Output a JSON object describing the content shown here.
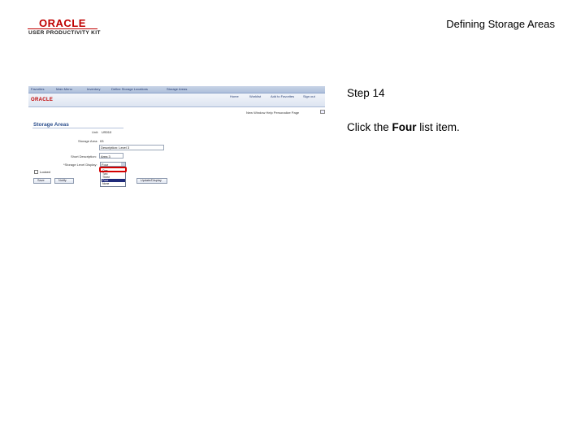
{
  "header": {
    "logo_brand": "ORACLE",
    "logo_sub": "USER PRODUCTIVITY KIT",
    "title": "Defining Storage Areas"
  },
  "step": {
    "label": "Step 14",
    "instruction_prefix": "Click the ",
    "instruction_target": "Four",
    "instruction_suffix": " list item."
  },
  "screenshot": {
    "breadcrumbs": [
      "Favorites",
      "Main Menu",
      "Inventory",
      "Define Storage Locations",
      "Storage Areas"
    ],
    "header_links": [
      "Home",
      "Worklist",
      "Add to Favorites",
      "Sign out"
    ],
    "brand": "ORACLE",
    "page_links": "New Window  Help  Personalize Page",
    "heading": "Storage Areas",
    "fields": {
      "unit_label": "Unit:",
      "unit_value": "US010",
      "area_label": "Storage Area:",
      "area_value": "03",
      "desc_value": "Description: Level 3",
      "short_desc_label": "Short Description:",
      "short_desc_value": "Area 3",
      "display_label": "*Storage Level Display:",
      "display_value": "Four",
      "locked_label": "Locked"
    },
    "level_options": [
      "One",
      "Two",
      "Three",
      "Four",
      "None"
    ],
    "selected_option": "Four",
    "buttons": {
      "save": "Save",
      "notify": "Notify",
      "update_display": "Update/Display"
    }
  }
}
